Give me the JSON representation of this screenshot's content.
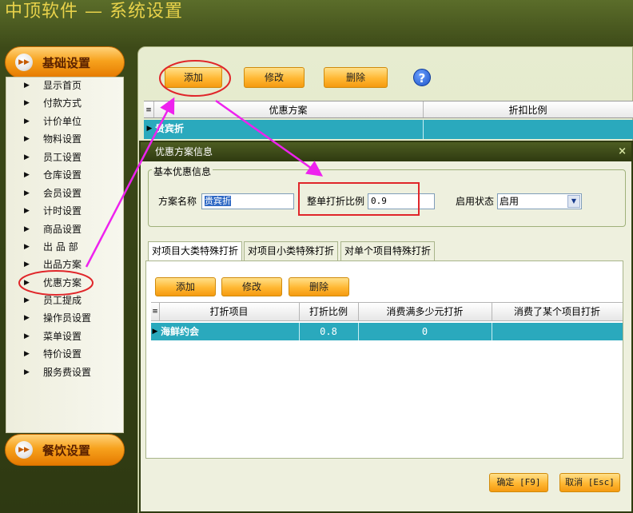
{
  "app": {
    "title": "中顶软件 — 系统设置"
  },
  "sidebar": {
    "section_base": "基础设置",
    "section_food": "餐饮设置",
    "items": [
      {
        "label": "显示首页"
      },
      {
        "label": "付款方式"
      },
      {
        "label": "计价单位"
      },
      {
        "label": "物料设置"
      },
      {
        "label": "员工设置"
      },
      {
        "label": "仓库设置"
      },
      {
        "label": "会员设置"
      },
      {
        "label": "计时设置"
      },
      {
        "label": "商品设置"
      },
      {
        "label": "出 品 部"
      },
      {
        "label": "出品方案"
      },
      {
        "label": "优惠方案"
      },
      {
        "label": "员工提成"
      },
      {
        "label": "操作员设置"
      },
      {
        "label": "菜单设置"
      },
      {
        "label": "特价设置"
      },
      {
        "label": "服务费设置"
      }
    ],
    "selected": "优惠方案"
  },
  "toolbar": {
    "add": "添加",
    "edit": "修改",
    "delete": "删除",
    "help_icon": "question-mark"
  },
  "main_grid": {
    "columns": [
      "优惠方案",
      "折扣比例"
    ],
    "rows": [
      {
        "name": "贵宾折",
        "ratio": ""
      }
    ]
  },
  "dialog": {
    "title": "优惠方案信息",
    "close": "×",
    "group_title": "基本优惠信息",
    "name_label": "方案名称",
    "name_value": "贵宾折",
    "ratio_label": "整单打折比例",
    "ratio_value": "0.9",
    "status_label": "启用状态",
    "status_value": "启用",
    "tabs": [
      "对项目大类特殊打折",
      "对项目小类特殊打折",
      "对单个项目特殊打折"
    ],
    "sub_toolbar": {
      "add": "添加",
      "edit": "修改",
      "delete": "删除"
    },
    "sub_grid": {
      "columns": [
        "打折项目",
        "打折比例",
        "消费满多少元打折",
        "消费了某个项目打折"
      ],
      "rows": [
        {
          "item": "海鲜约会",
          "ratio": "0.8",
          "min_spend": "0",
          "trigger_item": ""
        }
      ]
    },
    "ok": "确定 [F9]",
    "cancel": "取消 [Esc]"
  },
  "annotation_color": "#ee22ee",
  "highlight_color": "#e0262a",
  "accent_orange": "#f7a21d",
  "row_selected": "#2aa9bd"
}
